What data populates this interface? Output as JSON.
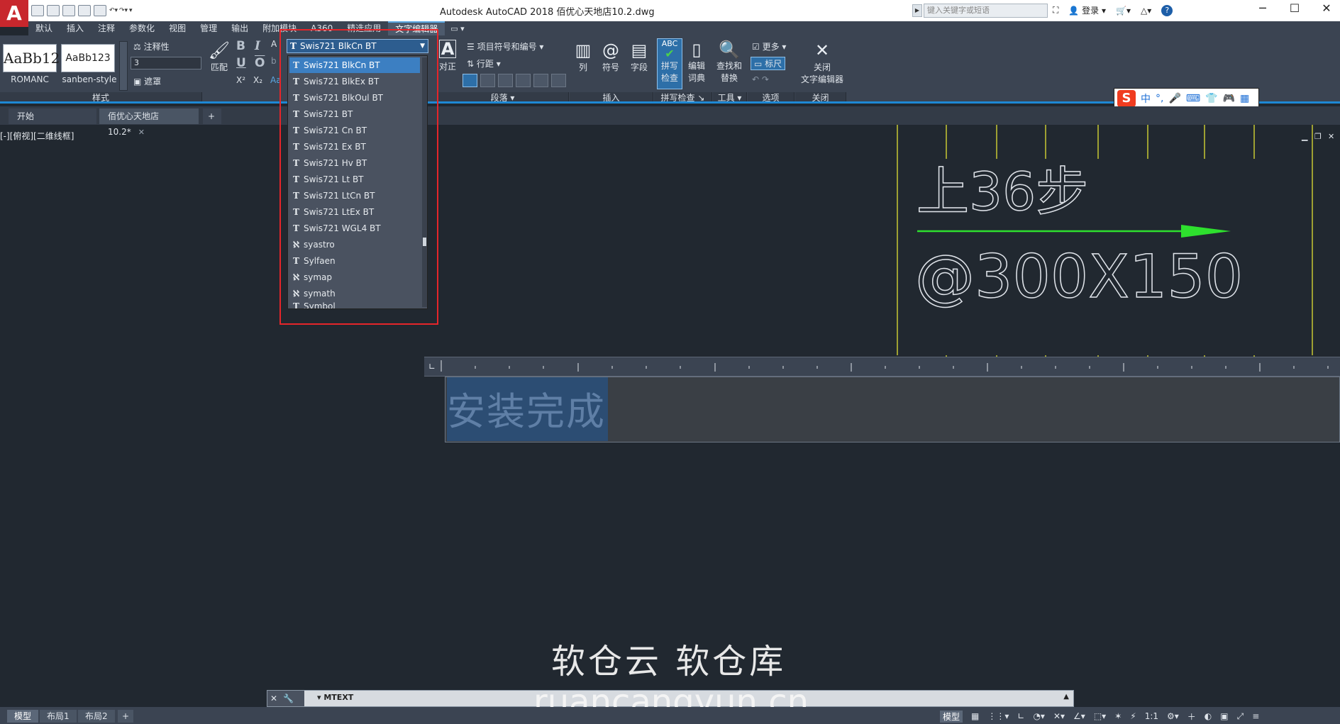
{
  "titlebar": {
    "app_logo": "A",
    "title": "Autodesk AutoCAD 2018    佰优心天地店10.2.dwg",
    "search_placeholder": "键入关键字或短语",
    "login": "登录",
    "help": "?"
  },
  "ribbon_tabs": [
    "默认",
    "插入",
    "注释",
    "参数化",
    "视图",
    "管理",
    "输出",
    "附加模块",
    "A360",
    "精选应用",
    "文字编辑器"
  ],
  "ribbon_tab_extra": "▭ ▾",
  "style_panel": {
    "swatch1_text": "AaBb12",
    "swatch1_label": "ROMANC",
    "swatch2_text": "AaBb123",
    "swatch2_label": "sanben-style",
    "annotative": "注释性",
    "text_height": "3",
    "mask": "遮罩",
    "footer": "样式"
  },
  "format_panel": {
    "match": "匹配",
    "bold": "B",
    "italic": "I",
    "underline": "U",
    "overline": "O",
    "superscript": "X²",
    "subscript": "X₂",
    "case": "Aa"
  },
  "font_combo": {
    "value": "Swis721 BlkCn BT"
  },
  "font_list": [
    {
      "name": "Swis721 BlkCn BT",
      "glyph": "T",
      "selected": true
    },
    {
      "name": "Swis721 BlkEx BT",
      "glyph": "T"
    },
    {
      "name": "Swis721 BlkOul BT",
      "glyph": "T"
    },
    {
      "name": "Swis721 BT",
      "glyph": "T"
    },
    {
      "name": "Swis721 Cn BT",
      "glyph": "T"
    },
    {
      "name": "Swis721 Ex BT",
      "glyph": "T"
    },
    {
      "name": "Swis721 Hv BT",
      "glyph": "T"
    },
    {
      "name": "Swis721 Lt BT",
      "glyph": "T"
    },
    {
      "name": "Swis721 LtCn BT",
      "glyph": "T"
    },
    {
      "name": "Swis721 LtEx BT",
      "glyph": "T"
    },
    {
      "name": "Swis721 WGL4 BT",
      "glyph": "T"
    },
    {
      "name": "syastro",
      "glyph": "ℵ"
    },
    {
      "name": "Sylfaen",
      "glyph": "T"
    },
    {
      "name": "symap",
      "glyph": "ℵ"
    },
    {
      "name": "symath",
      "glyph": "ℵ"
    },
    {
      "name": "Symbol",
      "glyph": "T"
    }
  ],
  "paragraph_panel": {
    "justify": "对正",
    "bullets": "项目符号和编号",
    "line_spacing": "行距",
    "footer": "段落"
  },
  "insert_panel": {
    "columns": "列",
    "symbol": "符号",
    "field": "字段",
    "footer": "插入"
  },
  "spell_panel": {
    "spell_check_top": "ABC",
    "spell_check_label1": "拼写",
    "spell_check_label2": "检查",
    "edit_dict1": "编辑",
    "edit_dict2": "词典",
    "footer": "拼写检查"
  },
  "tools_panel": {
    "find1": "查找和",
    "find2": "替换",
    "footer": "工具"
  },
  "options_panel": {
    "more": "更多",
    "ruler": "标尺",
    "footer": "选项"
  },
  "close_panel": {
    "label1": "关闭",
    "label2": "文字编辑器",
    "footer": "关闭"
  },
  "ime": {
    "logo": "S",
    "lang": "中",
    "punct": "°,",
    "icons": [
      "🎤",
      "⌨",
      "👕",
      "🎮",
      "▦"
    ]
  },
  "doc_tabs": [
    {
      "label": "开始"
    },
    {
      "label": "佰优心天地店10.2*",
      "active": true
    }
  ],
  "doc_tab_add": "+",
  "viewport_label": "[-][俯视][二维线框]",
  "drawing": {
    "text1": "上36步",
    "text2": "@300X150",
    "accent_arrow": "#2ee02e",
    "line_color": "#c8c832"
  },
  "mtext_content": "安装完成",
  "watermark": {
    "line1": "软仓云 软仓库",
    "line2": "ruancangyun.cn"
  },
  "command_line": {
    "text": "MTEXT"
  },
  "status_tabs": [
    "模型",
    "布局1",
    "布局2"
  ],
  "status_add": "+",
  "status_right": {
    "model": "模型",
    "scale": "1:1"
  }
}
